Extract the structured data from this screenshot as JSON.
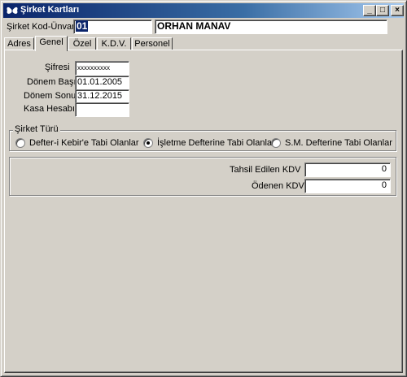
{
  "window": {
    "title": "Şirket Kartları",
    "controls": {
      "minimize": "_",
      "maximize": "□",
      "close": "×"
    }
  },
  "header": {
    "code_label": "Şirket Kod-Ünvanı",
    "code_value": "01",
    "name_value": "ORHAN MANAV"
  },
  "tabs": [
    {
      "label": "Adres"
    },
    {
      "label": "Genel",
      "active": true
    },
    {
      "label": "Özel"
    },
    {
      "label": "K.D.V."
    },
    {
      "label": "Personel"
    }
  ],
  "genel": {
    "password_label": "Şifresi",
    "password_value": "xxxxxxxxxx",
    "period_start_label": "Dönem Başı",
    "period_start_value": "01.01.2005",
    "period_end_label": "Dönem Sonu",
    "period_end_value": "31.12.2015",
    "cash_account_label": "Kasa Hesabı",
    "cash_account_value": ""
  },
  "company_type": {
    "caption": "Şirket Türü",
    "options": [
      {
        "label": "Defter-i Kebir'e Tabi Olanlar",
        "selected": false
      },
      {
        "label": "İşletme Defterine Tabi Olanlar",
        "selected": true
      },
      {
        "label": "S.M. Defterine Tabi Olanlar",
        "selected": false
      }
    ]
  },
  "kdv": {
    "collected_label": "Tahsil Edilen KDV",
    "collected_value": "0",
    "paid_label": "Ödenen KDV",
    "paid_value": "0"
  },
  "colors": {
    "titlebar_start": "#0a246a",
    "titlebar_end": "#a6caf0",
    "face": "#d4d0c8"
  },
  "icons": [
    "butterfly-app-icon",
    "minimize-icon",
    "maximize-icon",
    "close-icon",
    "radio-icon"
  ]
}
